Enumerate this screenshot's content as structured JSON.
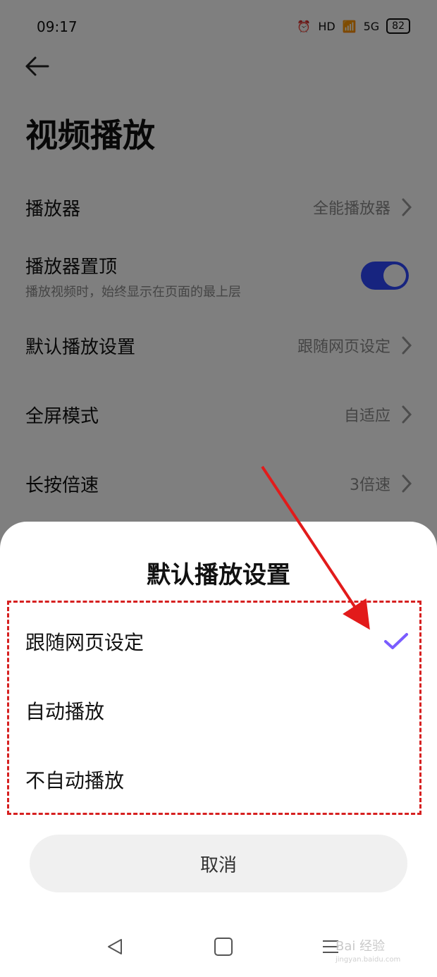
{
  "status_bar": {
    "time": "09:17",
    "signal_label": "5G",
    "hd_label": "HD",
    "battery": "82"
  },
  "page": {
    "title": "视频播放"
  },
  "settings": [
    {
      "label": "播放器",
      "value": "全能播放器"
    },
    {
      "label": "播放器置顶",
      "sublabel": "播放视频时，始终显示在页面的最上层",
      "toggle": true
    },
    {
      "label": "默认播放设置",
      "value": "跟随网页设定"
    },
    {
      "label": "全屏模式",
      "value": "自适应"
    },
    {
      "label": "长按倍速",
      "value": "3倍速"
    }
  ],
  "sheet": {
    "title": "默认播放设置",
    "options": [
      {
        "label": "跟随网页设定",
        "selected": true
      },
      {
        "label": "自动播放",
        "selected": false
      },
      {
        "label": "不自动播放",
        "selected": false
      }
    ],
    "cancel_label": "取消"
  },
  "watermark": {
    "brand": "Bai 经验",
    "url": "jingyan.baidu.com"
  },
  "colors": {
    "toggle": "#2f49ff",
    "check": "#7a5cff",
    "annotation": "#d62020"
  }
}
